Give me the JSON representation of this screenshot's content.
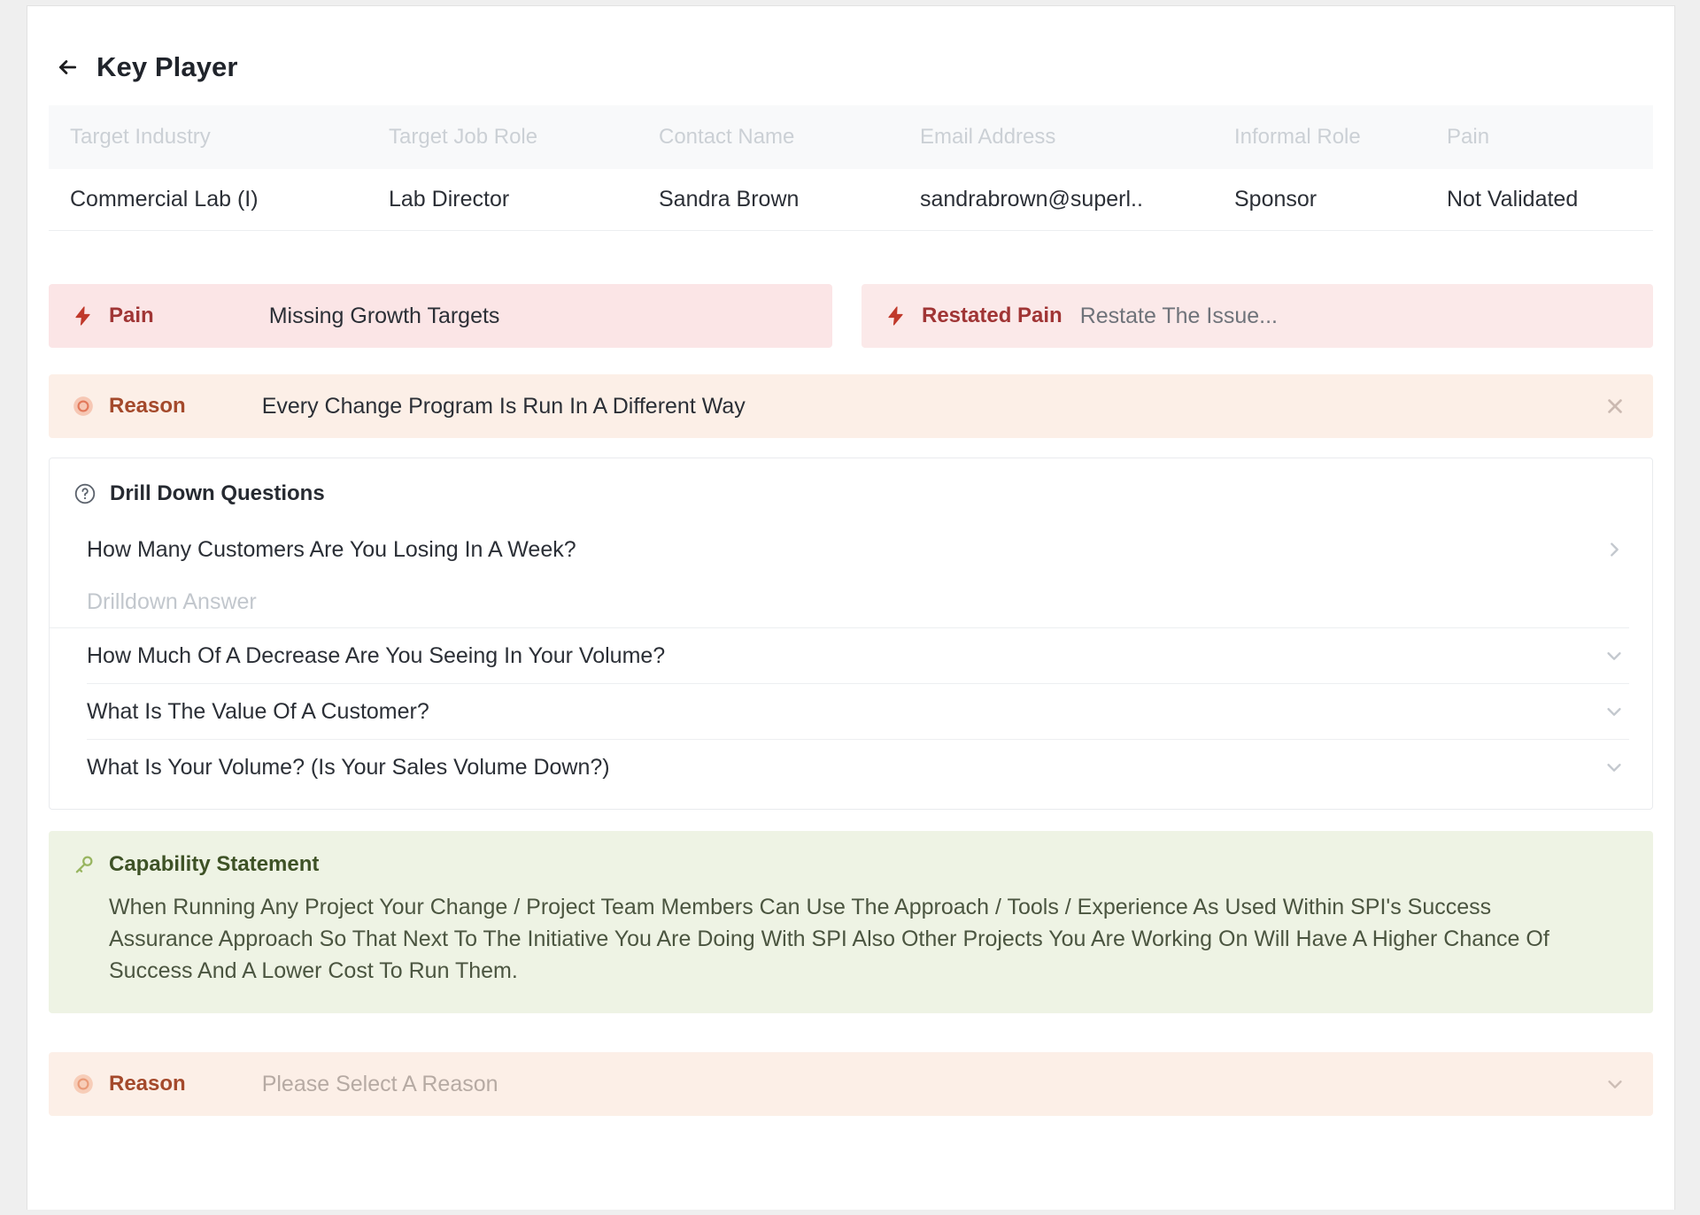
{
  "header": {
    "back_icon": "arrow-left-icon",
    "title": "Key Player"
  },
  "table": {
    "columns": [
      "Target Industry",
      "Target Job Role",
      "Contact Name",
      "Email Address",
      "Informal Role",
      "Pain"
    ],
    "rows": [
      {
        "target_industry": "Commercial Lab (I)",
        "target_job_role": "Lab Director",
        "contact_name": "Sandra Brown",
        "email_address": "sandrabrown@superl..",
        "informal_role": "Sponsor",
        "pain": "Not Validated"
      }
    ]
  },
  "pain_band": {
    "icon": "lightning-bolt-icon",
    "label": "Pain",
    "value": "Missing Growth Targets"
  },
  "restated_pain_band": {
    "icon": "lightning-bolt-icon",
    "label": "Restated Pain",
    "placeholder": "Restate The Issue..."
  },
  "reason_band": {
    "icon": "reason-dot-icon",
    "label": "Reason",
    "value": "Every Change Program Is Run In A Different Way",
    "close_icon": "close-icon"
  },
  "drill_down": {
    "icon": "question-circle-icon",
    "title": "Drill Down Questions",
    "questions": [
      {
        "text": "How Many Customers Are You Losing In A Week?",
        "chevron": "chevron-right-icon",
        "expanded": true,
        "answer_placeholder": "Drilldown Answer"
      },
      {
        "text": "How Much Of A Decrease Are You Seeing In Your Volume?",
        "chevron": "chevron-down-icon",
        "expanded": false
      },
      {
        "text": "What Is The Value Of A Customer?",
        "chevron": "chevron-down-icon",
        "expanded": false
      },
      {
        "text": "What Is Your Volume? (Is Your Sales Volume Down?)",
        "chevron": "chevron-down-icon",
        "expanded": false
      }
    ]
  },
  "capability": {
    "icon": "key-icon",
    "title": "Capability Statement",
    "body": "When Running Any Project Your Change / Project Team Members Can Use The Approach / Tools / Experience As Used Within SPI's Success Assurance Approach So That Next To The Initiative You Are Doing With SPI Also Other Projects You Are Working On Will Have A Higher Chance Of Success And A Lower Cost To Run Them."
  },
  "reason_bottom_band": {
    "icon": "reason-dot-icon",
    "label": "Reason",
    "placeholder": "Please Select A Reason",
    "chevron": "chevron-down-icon"
  },
  "colors": {
    "pain_bg": "#fbe5e6",
    "restated_bg": "#fbe9e9",
    "reason_bg": "#fcefe7",
    "capability_bg": "#eef3e4",
    "pain_label": "#a03535",
    "reason_label": "#a4492b",
    "capability_label": "#3e5226",
    "table_head_bg": "#f0f2f5"
  }
}
